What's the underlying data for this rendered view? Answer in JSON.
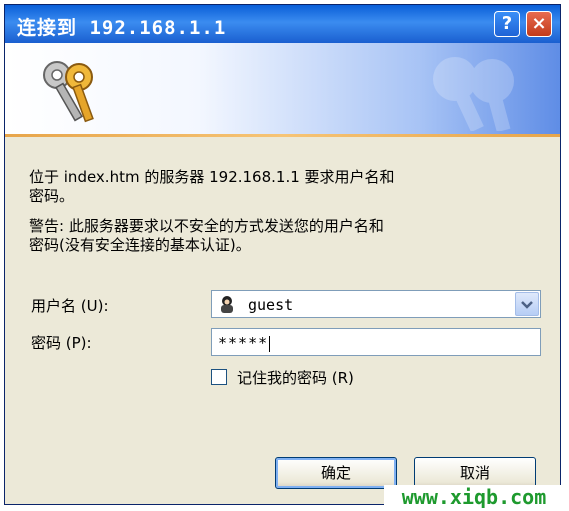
{
  "dialog": {
    "title": "连接到 192.168.1.1",
    "help_button": "?",
    "close_button": "×",
    "message1_line1": "位于 index.htm 的服务器 192.168.1.1 要求用户名和",
    "message1_line2": "密码。",
    "message2_line1": "警告: 此服务器要求以不安全的方式发送您的用户名和",
    "message2_line2": "密码(没有安全连接的基本认证)。",
    "username_label": "用户名 (U):",
    "username_value": "guest",
    "password_label": "密码 (P):",
    "password_value": "*****",
    "remember_label": "记住我的密码 (R)",
    "remember_checked": false,
    "ok_button": "确定",
    "cancel_button": "取消"
  },
  "watermark": "www.xiqb.com",
  "colors": {
    "titlebar": "#0a5fd8",
    "window_bg": "#ece9d8",
    "watermark": "#1e9a2e"
  },
  "icons": {
    "banner": "keys-icon",
    "combo_user": "user-icon",
    "combo_dropdown": "chevron-down-icon"
  }
}
